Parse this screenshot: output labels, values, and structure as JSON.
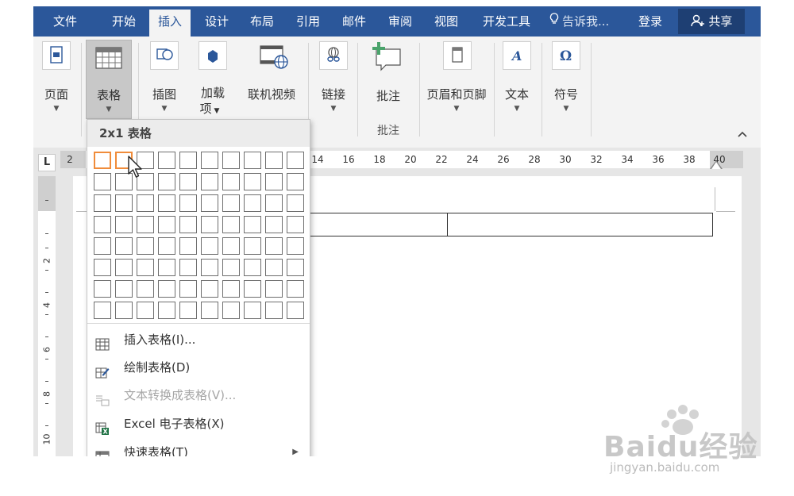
{
  "tabs": [
    "文件",
    "开始",
    "插入",
    "设计",
    "布局",
    "引用",
    "邮件",
    "审阅",
    "视图",
    "开发工具"
  ],
  "active_tab": "插入",
  "tell_me": "告诉我...",
  "login": "登录",
  "share": "共享",
  "ribbon": {
    "page": "页面",
    "table": "表格",
    "illustrations": "插图",
    "addins_line1": "加载",
    "addins_line2": "项",
    "online_video": "联机视频",
    "link": "链接",
    "comment": "批注",
    "comment_group": "批注",
    "header_footer": "页眉和页脚",
    "text": "文本",
    "symbols": "符号"
  },
  "ruler_ticks": [
    "2",
    "14",
    "16",
    "18",
    "20",
    "22",
    "24",
    "26",
    "28",
    "30",
    "32",
    "34",
    "36",
    "38",
    "40"
  ],
  "vruler_numbers": [
    "2",
    "4",
    "6",
    "8",
    "10"
  ],
  "dropdown": {
    "header": "2x1 表格",
    "grid_cols": 10,
    "grid_rows": 8,
    "selected_cols": 2,
    "selected_rows": 1,
    "items": [
      {
        "label": "插入表格(I)...",
        "disabled": false
      },
      {
        "label": "绘制表格(D)",
        "disabled": false
      },
      {
        "label": "文本转换成表格(V)...",
        "disabled": true
      },
      {
        "label": "Excel 电子表格(X)",
        "disabled": false
      },
      {
        "label": "快速表格(T)",
        "disabled": false
      }
    ]
  },
  "watermark": {
    "brand": "Baidu经验",
    "url": "jingyan.baidu.com"
  },
  "colors": {
    "tab_bar": "#2b579a",
    "selection": "#f08c3a"
  }
}
